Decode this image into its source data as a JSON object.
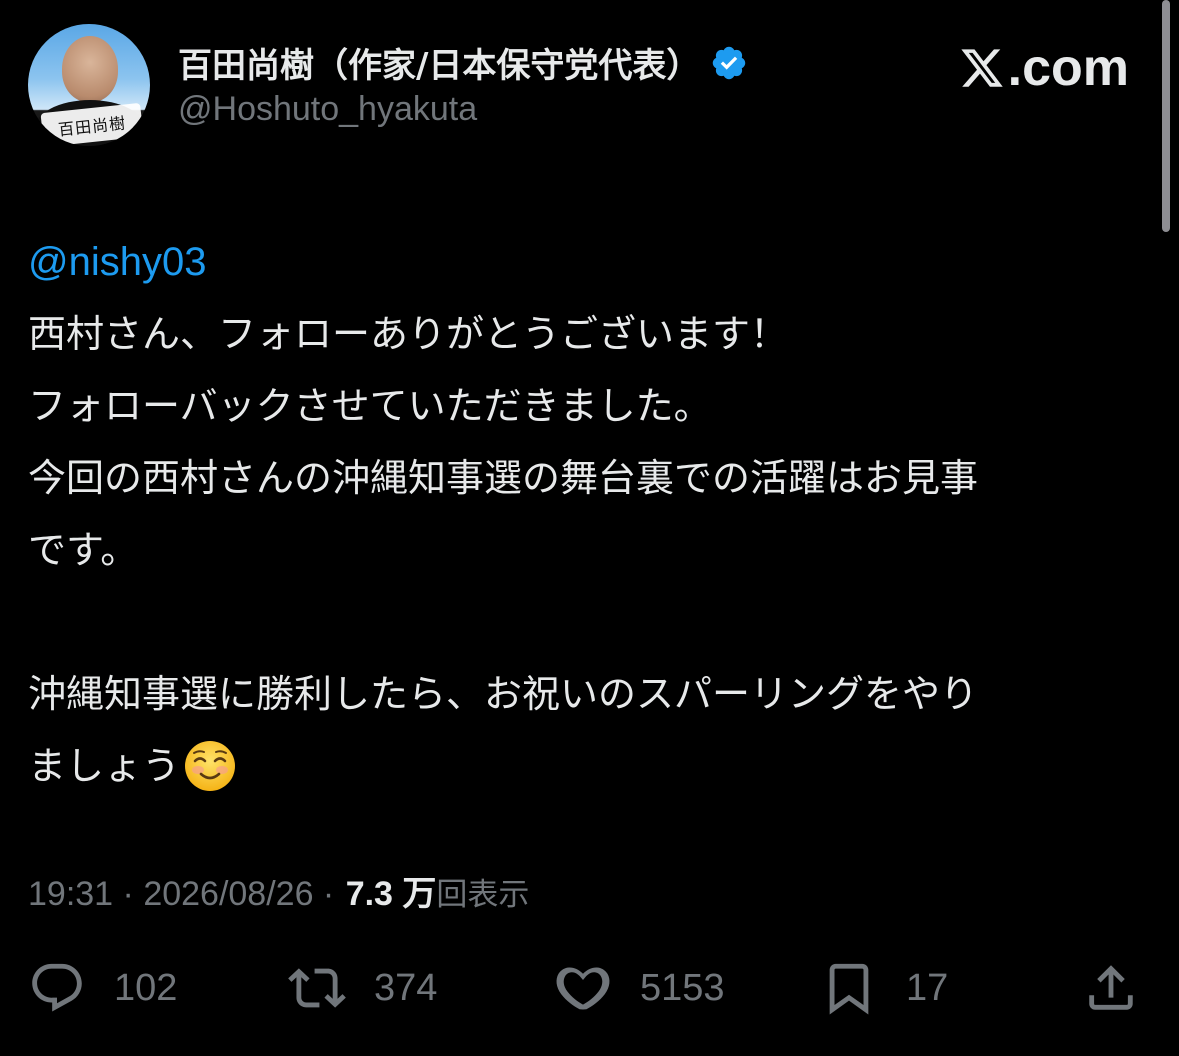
{
  "header": {
    "display_name": "百田尚樹（作家/日本保守党代表）",
    "handle": "@Hoshuto_hyakuta",
    "avatar_sign_text": "百田尚樹",
    "brand": ".com",
    "verified_color": "#1d9bf0"
  },
  "tweet": {
    "mention": "@nishy03",
    "lines": [
      "西村さん、フォローありがとうございます！",
      "フォローバックさせていただきました。",
      "今回の西村さんの沖縄知事選の舞台裏での活躍はお見事",
      "です。",
      "",
      "沖縄知事選に勝利したら、お祝いのスパーリングをやり",
      "ましょう"
    ],
    "emoji": "smiling-face-icon"
  },
  "meta": {
    "time": "19:31",
    "separator": " · ",
    "date": "2026/08/26",
    "separator2": " · ",
    "views_count": "7.3 万",
    "views_label": "回表示"
  },
  "actions": {
    "reply_count": "102",
    "repost_count": "374",
    "like_count": "5153",
    "bookmark_count": "17"
  },
  "colors": {
    "background": "#000000",
    "text": "#e7e9ea",
    "secondary": "#71767b",
    "accent": "#1d9bf0"
  }
}
